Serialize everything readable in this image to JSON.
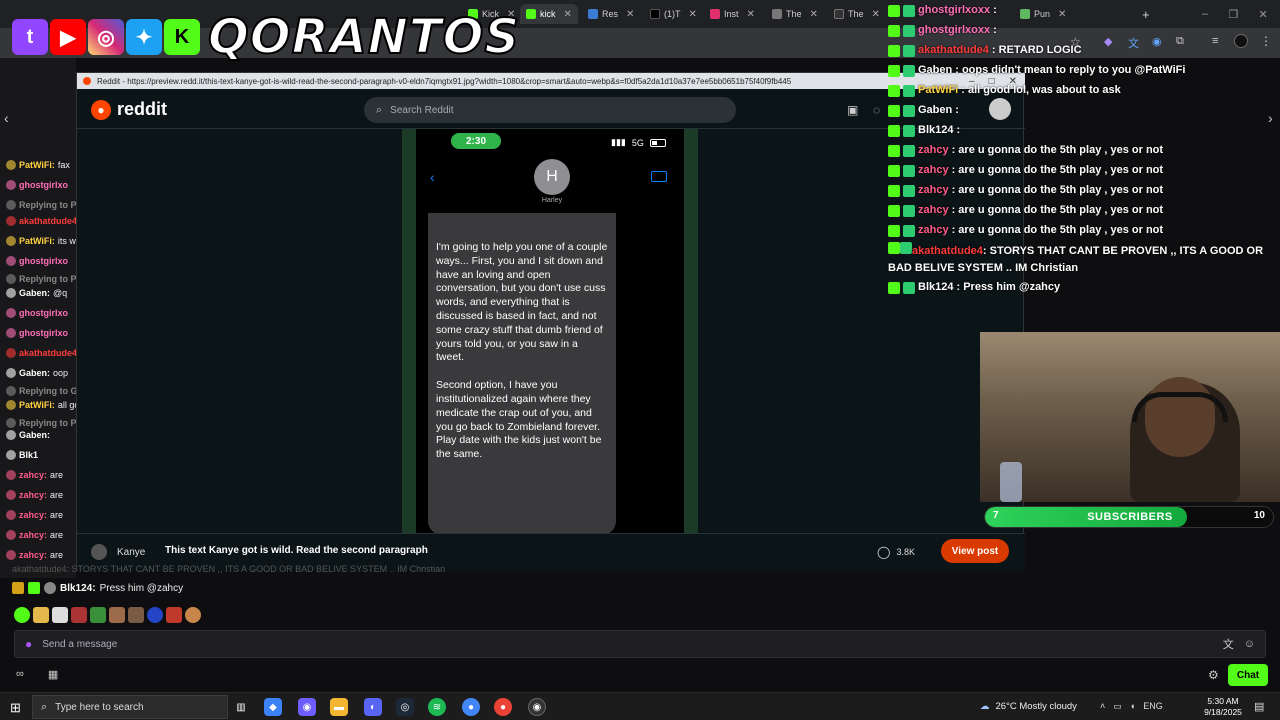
{
  "browser": {
    "tabs": [
      {
        "label": "Kick",
        "color": "#53fc18"
      },
      {
        "label": "kick",
        "color": "#53fc18"
      },
      {
        "label": "Res",
        "color": "#3a7bd5"
      },
      {
        "label": "(1)T",
        "color": "#000000"
      },
      {
        "label": "Inst",
        "color": "#e1306c"
      },
      {
        "label": "The",
        "color": "#777777"
      },
      {
        "label": "The",
        "color": "#333333"
      },
      {
        "label": "Pun",
        "color": "#5fb760"
      }
    ],
    "new_tab": "+"
  },
  "brand": {
    "name": "QORANTOS",
    "icons": [
      "twitch-icon",
      "youtube-icon",
      "instagram-icon",
      "twitter-icon",
      "kick-icon"
    ]
  },
  "popup": {
    "title": "Reddit - https://preview.redd.it/this-text-kanye-got-is-wild-read-the-second-paragraph-v0-eldn7iqmgtx91.jpg?width=1080&crop=smart&auto=webp&s=f0df5a2da1d10a37e7ee5bb0651b75f40f9fb445"
  },
  "reddit": {
    "logo_text": "reddit",
    "search_placeholder": "Search Reddit"
  },
  "phone": {
    "time": "2:30",
    "network": "5G",
    "contact_initial": "H",
    "contact_name": "Harley",
    "paragraph1": "I'm going to help you one of a couple ways... First, you and I sit down and have an loving and open  conversation, but you don't use cuss words, and everything that is discussed is based in fact, and not some crazy stuff that dumb friend of yours told you, or you saw in a tweet.",
    "paragraph2": "Second option, I have you institutionalized again where they medicate the crap out of you, and you go back to Zombieland forever. Play date with the kids just won't be the same."
  },
  "post": {
    "author": "Kanye",
    "title": "This text Kanye got is wild. Read the second paragraph",
    "comments": "3.8K",
    "view_post": "View post"
  },
  "left_chat": [
    {
      "name": "PatWiFi:",
      "text": "fax",
      "color": "#ffd23f"
    },
    {
      "name": "ghostgirlxo",
      "text": "",
      "color": "#ff6fb7"
    },
    {
      "name": "Replying to P",
      "text": "",
      "color": "#888888"
    },
    {
      "name": "akathatdude4:",
      "text": "",
      "color": "#ff3b3b"
    },
    {
      "name": "PatWiFi:",
      "text": "its wic",
      "color": "#ffd23f"
    },
    {
      "name": "ghostgirlxo",
      "text": "",
      "color": "#ff6fb7"
    },
    {
      "name": "Replying to P",
      "text": "",
      "color": "#888888"
    },
    {
      "name": "Gaben:",
      "text": "@q",
      "color": "#ffffff"
    },
    {
      "name": "ghostgirlxo",
      "text": "",
      "color": "#ff6fb7"
    },
    {
      "name": "ghostgirlxo",
      "text": "",
      "color": "#ff6fb7"
    },
    {
      "name": "akathatdude4:",
      "text": "",
      "color": "#ff3b3b"
    },
    {
      "name": "Gaben:",
      "text": "oop",
      "color": "#ffffff"
    },
    {
      "name": "Replying to G",
      "text": "",
      "color": "#888888"
    },
    {
      "name": "PatWiFi:",
      "text": "all go",
      "color": "#ffd23f"
    },
    {
      "name": "Replying to P",
      "text": "",
      "color": "#888888"
    },
    {
      "name": "Gaben:",
      "text": "",
      "color": "#ffffff"
    },
    {
      "name": "Blk1",
      "text": "",
      "color": "#ffffff"
    },
    {
      "name": "zahcy:",
      "text": "are",
      "color": "#ff5b8a"
    },
    {
      "name": "zahcy:",
      "text": "are",
      "color": "#ff5b8a"
    },
    {
      "name": "zahcy:",
      "text": "are",
      "color": "#ff5b8a"
    },
    {
      "name": "zahcy:",
      "text": "are",
      "color": "#ff5b8a"
    },
    {
      "name": "zahcy:",
      "text": "are",
      "color": "#ff5b8a"
    }
  ],
  "right_chat": [
    {
      "name": "ghostgirlxoxx",
      "text": ":",
      "color": "#ff6fb7"
    },
    {
      "name": "ghostgirlxoxx",
      "text": ":",
      "color": "#ff6fb7"
    },
    {
      "name": "akathatdude4",
      "text": ": RETARD LOGIC",
      "color": "#ff3b3b"
    },
    {
      "name": "Gaben",
      "text": ": oops didn't mean to reply to you @PatWiFi",
      "color": "#ffffff"
    },
    {
      "name": "PatWiFi",
      "text": ": all good lol, was about to ask",
      "color": "#ffd23f"
    },
    {
      "name": "Gaben",
      "text": ":",
      "color": "#ffffff"
    },
    {
      "name": "Blk124",
      "text": ":",
      "color": "#ffffff"
    },
    {
      "name": "zahcy",
      "text": ": are u gonna do the 5th play , yes or not",
      "color": "#ff5b8a"
    },
    {
      "name": "zahcy",
      "text": ": are u gonna do the 5th play , yes or not",
      "color": "#ff5b8a"
    },
    {
      "name": "zahcy",
      "text": ": are u gonna do the 5th play , yes or not",
      "color": "#ff5b8a"
    },
    {
      "name": "zahcy",
      "text": ": are u gonna do the 5th play , yes or not",
      "color": "#ff5b8a"
    },
    {
      "name": "zahcy",
      "text": ": are u gonna do the 5th play , yes or not",
      "color": "#ff5b8a"
    },
    {
      "name": "akathatdude4",
      "text": ": STORYS THAT CANT BE PROVEN ,, ITS A GOOD OR BAD BELIVE SYSTEM .. IM Christian",
      "color": "#ff3b3b"
    },
    {
      "name": "Blk124",
      "text": ": Press him @zahcy",
      "color": "#ffffff"
    }
  ],
  "subscribers": {
    "label": "SUBSCRIBERS",
    "current": "7",
    "goal": "10",
    "progress": 0.7
  },
  "bottom_chat": {
    "faded_line": "akathatdude4: STORYS THAT CANT BE PROVEN ,, ITS A GOOD OR BAD BELIVE SYSTEM .. IM Christian",
    "name": "Blk124:",
    "text": "Press him @zahcy",
    "input_placeholder": "Send a message",
    "chat_button": "Chat"
  },
  "taskbar": {
    "search_placeholder": "Type here to search",
    "weather": "26°C  Mostly cloudy",
    "lang": "ENG",
    "time": "5:30 AM",
    "date": "9/18/2025"
  }
}
